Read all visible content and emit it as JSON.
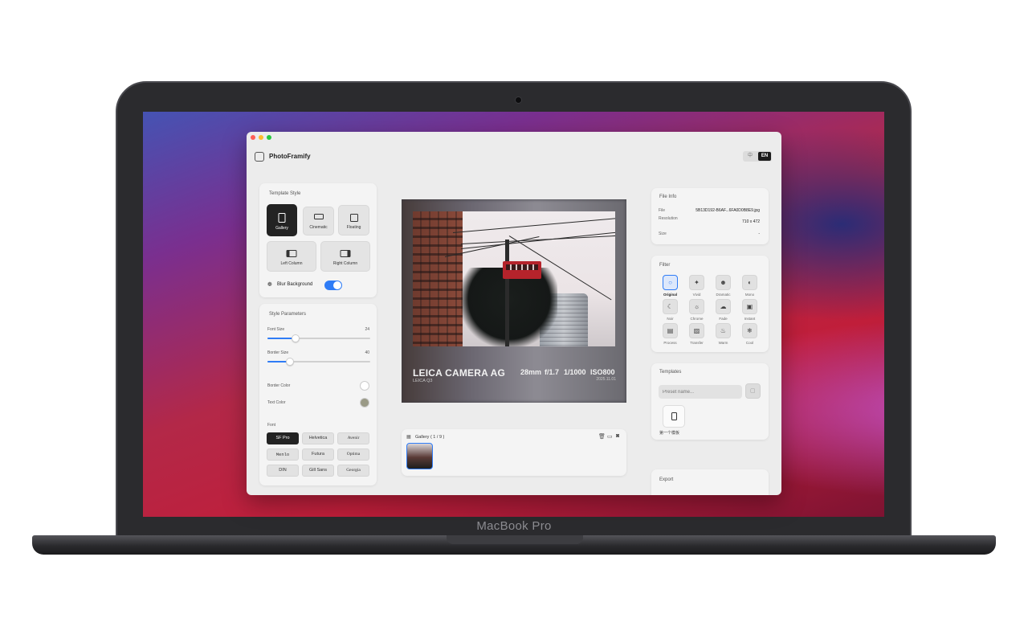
{
  "device": {
    "label": "MacBook Pro"
  },
  "app": {
    "title": "PhotoFramify",
    "languages": [
      {
        "label": "中",
        "active": false
      },
      {
        "label": "EN",
        "active": true
      }
    ]
  },
  "template_style": {
    "title": "Template Style",
    "options": [
      {
        "label": "Gallery",
        "active": true
      },
      {
        "label": "Cinematic",
        "active": false
      },
      {
        "label": "Floating",
        "active": false
      },
      {
        "label": "Left Column",
        "active": false
      },
      {
        "label": "Right Column",
        "active": false
      }
    ],
    "blur_background": {
      "label": "Blur Background",
      "enabled": true
    }
  },
  "style_parameters": {
    "title": "Style Parameters",
    "font_size": {
      "label": "Font Size",
      "value": "24",
      "fraction": 0.27
    },
    "border_size": {
      "label": "Border Size",
      "value": "40",
      "fraction": 0.22
    },
    "border_color": {
      "label": "Border Color",
      "color": "#ffffff"
    },
    "text_color": {
      "label": "Text Color",
      "color": "#9a9a86"
    },
    "font": {
      "label": "Font",
      "options": [
        "SF Pro",
        "Helvetica",
        "Avenir",
        "Menlo",
        "Futura",
        "Optima",
        "DIN",
        "Gill Sans",
        "Georgia"
      ],
      "selected": "SF Pro"
    }
  },
  "preview": {
    "camera_make": "LEICA CAMERA AG",
    "camera_model": "LEICA Q3",
    "focal_length": "28mm",
    "aperture": "f/1.7",
    "shutter": "1/1000",
    "iso": "ISO800",
    "date": "2025.11.01"
  },
  "gallery": {
    "label": "Gallery ( 1 / 9 )"
  },
  "file_info": {
    "title": "File Info",
    "file_label": "File",
    "file_value": "5B13D192-B6AF...6FA0D0B8E9.jpg",
    "resolution_label": "Resolution",
    "resolution_value": "710 x 472",
    "size_label": "Size",
    "size_value": "-"
  },
  "filter": {
    "title": "Filter",
    "items": [
      {
        "label": "Original",
        "icon": "circle-icon",
        "glyph": "○",
        "active": true
      },
      {
        "label": "Vivid",
        "icon": "sparkle-icon",
        "glyph": "✦",
        "active": false
      },
      {
        "label": "Dramatic",
        "icon": "masks-icon",
        "glyph": "☻",
        "active": false
      },
      {
        "label": "Mono",
        "icon": "half-circle-icon",
        "glyph": "◐",
        "active": false
      },
      {
        "label": "Noir",
        "icon": "moon-icon",
        "glyph": "☾",
        "active": false
      },
      {
        "label": "Chrome",
        "icon": "sun-icon",
        "glyph": "☼",
        "active": false
      },
      {
        "label": "Fade",
        "icon": "cloud-icon",
        "glyph": "☁",
        "active": false
      },
      {
        "label": "Instant",
        "icon": "camera-icon",
        "glyph": "▣",
        "active": false
      },
      {
        "label": "Process",
        "icon": "film-icon",
        "glyph": "▤",
        "active": false
      },
      {
        "label": "Transfer",
        "icon": "photo-icon",
        "glyph": "▨",
        "active": false
      },
      {
        "label": "Warm",
        "icon": "flame-icon",
        "glyph": "♨",
        "active": false
      },
      {
        "label": "Cool",
        "icon": "snowflake-icon",
        "glyph": "❄",
        "active": false
      }
    ]
  },
  "templates": {
    "title": "Templates",
    "placeholder": "Preset name...",
    "presets": [
      {
        "label": "第一个模板"
      }
    ]
  },
  "export": {
    "title": "Export"
  }
}
